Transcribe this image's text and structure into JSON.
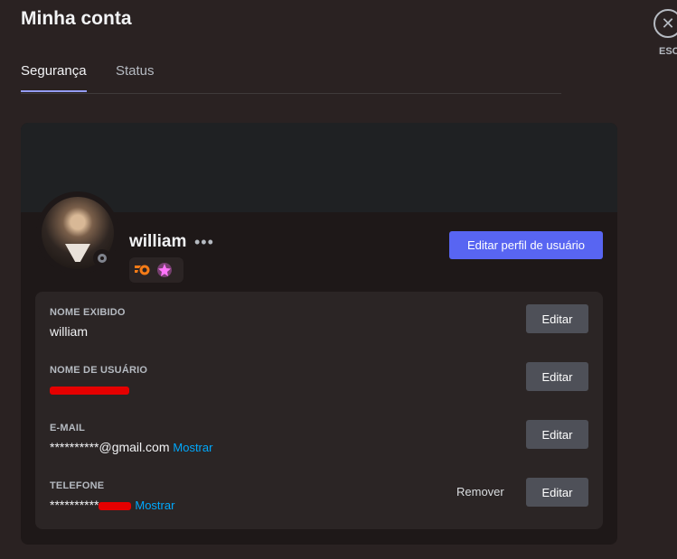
{
  "header": {
    "title": "Minha conta"
  },
  "tabs": [
    {
      "label": "Segurança",
      "active": true
    },
    {
      "label": "Status",
      "active": false
    }
  ],
  "close": {
    "icon": "close-icon",
    "label": "ESC"
  },
  "profile": {
    "username": "william",
    "more_label": "•••",
    "edit_profile_label": "Editar perfil de usuário",
    "status": "offline",
    "badges": [
      "hypesquad-icon",
      "nitro-icon"
    ]
  },
  "fields": {
    "display_name": {
      "label": "NOME EXIBIDO",
      "value": "william",
      "edit_label": "Editar"
    },
    "username": {
      "label": "NOME DE USUÁRIO",
      "value": "",
      "edit_label": "Editar"
    },
    "email": {
      "label": "E-MAIL",
      "value": "**********@gmail.com",
      "show_label": "Mostrar",
      "edit_label": "Editar"
    },
    "phone": {
      "label": "TELEFONE",
      "value": "**********",
      "show_label": "Mostrar",
      "remove_label": "Remover",
      "edit_label": "Editar"
    }
  },
  "colors": {
    "accent": "#5865f2",
    "background": "#2a2222",
    "card": "#1e1818",
    "link": "#00a8fc",
    "redaction": "#e50000"
  }
}
